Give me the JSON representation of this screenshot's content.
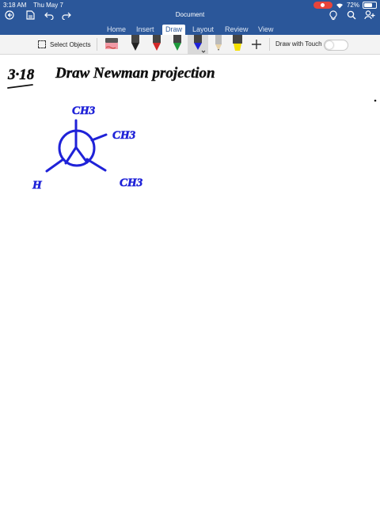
{
  "status_bar": {
    "time": "3:18 AM",
    "date": "Thu May 7",
    "battery": "72%",
    "battery_level": 0.72
  },
  "header": {
    "title": "Document"
  },
  "tabs": [
    {
      "label": "Home"
    },
    {
      "label": "Insert"
    },
    {
      "label": "Draw"
    },
    {
      "label": "Layout"
    },
    {
      "label": "Review"
    },
    {
      "label": "View"
    }
  ],
  "toolbar": {
    "select_label": "Select Objects",
    "draw_touch_label": "Draw with Touch"
  },
  "colors": {
    "ribbon": "#2b579a",
    "ink": "#1f22d8",
    "pen_black": "#222222",
    "pen_red": "#d22828",
    "pen_green": "#1f9a3c",
    "pen_blue": "#1f22d8",
    "highlighter": "#f5e000"
  },
  "handwriting": {
    "problem_number": "3·18",
    "heading": "Draw Newman projection",
    "label_top": "CH3",
    "label_right": "CH3",
    "label_left": "H",
    "label_bottom_right": "CH3"
  }
}
